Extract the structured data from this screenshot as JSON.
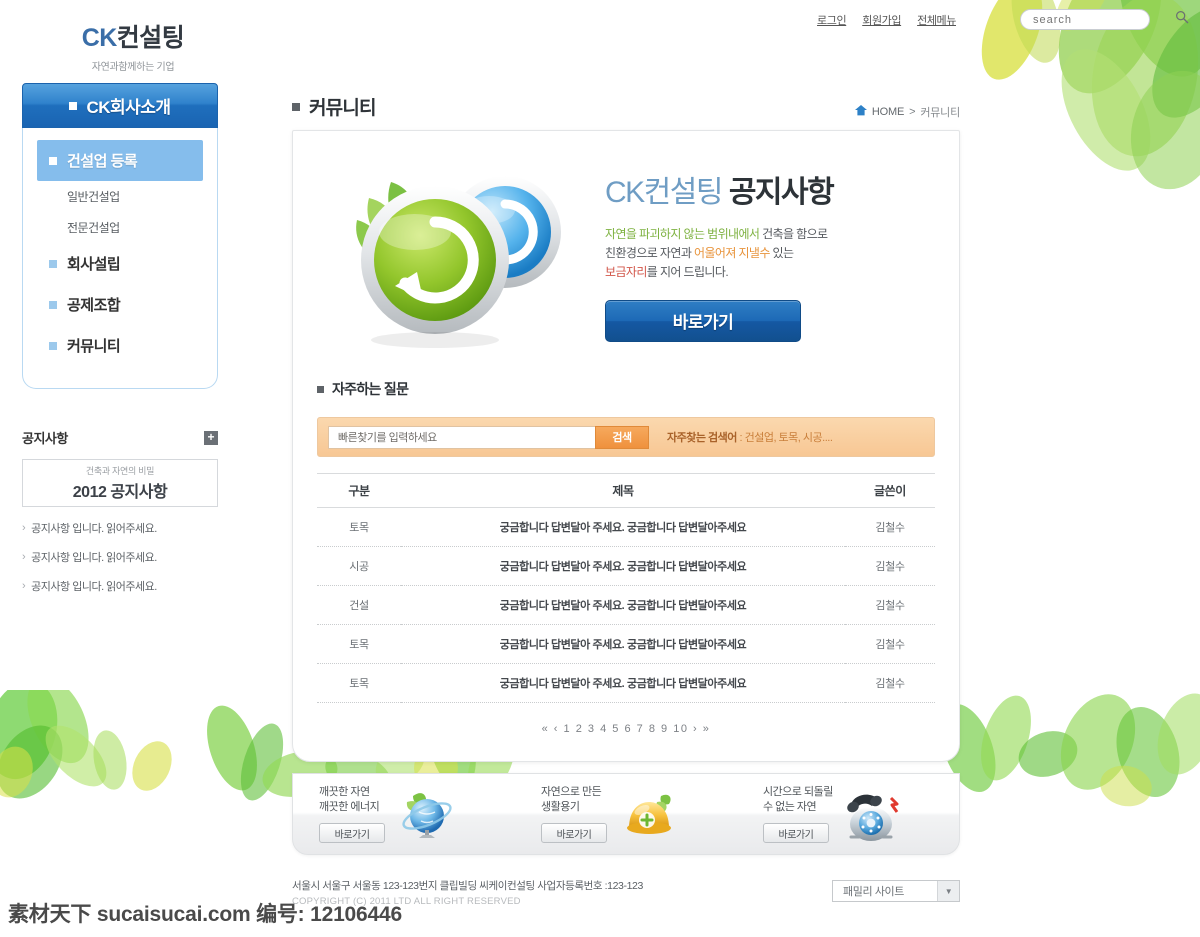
{
  "brand": {
    "logo_ck": "CK",
    "logo_kor": "컨설팅",
    "tagline": "자연과함께하는 기업"
  },
  "utility_nav": {
    "items": [
      {
        "label": "로그인"
      },
      {
        "label": "회원가입"
      },
      {
        "label": "전체메뉴"
      }
    ],
    "search_placeholder": "search",
    "search_value": ""
  },
  "sidebar": {
    "header": "CK회사소개",
    "items": [
      {
        "label": "건설업 등록",
        "active": true
      },
      {
        "label": "회사설립",
        "active": false
      },
      {
        "label": "공제조합",
        "active": false
      },
      {
        "label": "커뮤니티",
        "active": false
      }
    ],
    "sub_items": [
      {
        "label": "일반건설업"
      },
      {
        "label": "전문건설업"
      }
    ]
  },
  "notice": {
    "title": "공지사항",
    "plus": "+",
    "banner_small": "건축과 자연의 비밀",
    "banner_big": "2012 공지사항",
    "links": [
      {
        "label": "공지사항 입니다. 읽어주세요."
      },
      {
        "label": "공지사항 입니다. 읽어주세요."
      },
      {
        "label": "공지사항 입니다. 읽어주세요."
      }
    ]
  },
  "page": {
    "title": "커뮤니티",
    "breadcrumb_home": "HOME",
    "breadcrumb_sep": ">",
    "breadcrumb_current": "커뮤니티"
  },
  "hero": {
    "title_light": "CK컨설팅",
    "title_bold": "공지사항",
    "line1_a": "자연을 파괴하지 않는 범위내에서",
    "line1_b": " 건축을 함으로",
    "line2_a": "친환경으로 자연과 ",
    "line2_b": "어울어져 지낼수",
    "line2_c": " 있는",
    "line3_a": "보금자리",
    "line3_b": "를 지어 드립니다.",
    "button": "바로가기"
  },
  "faq": {
    "section_title": "자주하는 질문",
    "input_value": "빠른찾기를 입력하세요",
    "input_placeholder": "빠른찾기를 입력하세요",
    "search_button": "검색",
    "hint_label": "자주찾는 검색어",
    "hint_value": ": 건설업, 토목, 시공....",
    "columns": [
      "구분",
      "제목",
      "글쓴이"
    ],
    "rows": [
      {
        "category": "토목",
        "title": "궁금합니다 답변달아 주세요. 궁금합니다 답변달아주세요",
        "author": "김철수"
      },
      {
        "category": "시공",
        "title": "궁금합니다 답변달아 주세요. 궁금합니다 답변달아주세요",
        "author": "김철수"
      },
      {
        "category": "건설",
        "title": "궁금합니다 답변달아 주세요. 궁금합니다 답변달아주세요",
        "author": "김철수"
      },
      {
        "category": "토목",
        "title": "궁금합니다 답변달아 주세요. 궁금합니다 답변달아주세요",
        "author": "김철수"
      },
      {
        "category": "토목",
        "title": "궁금합니다 답변달아 주세요. 궁금합니다 답변달아주세요",
        "author": "김철수"
      }
    ],
    "pagination": {
      "first": "«",
      "prev": "‹",
      "pages": [
        "1",
        "2",
        "3",
        "4",
        "5",
        "6",
        "7",
        "8",
        "9",
        "10"
      ],
      "next": "›",
      "last": "»"
    }
  },
  "footer_banner": {
    "cells": [
      {
        "line1": "깨끗한 자연",
        "line2": "깨끗한 에너지",
        "button": "바로가기",
        "icon": "globe-icon"
      },
      {
        "line1": "자연으로 만든",
        "line2": "생활용기",
        "button": "바로가기",
        "icon": "helmet-icon"
      },
      {
        "line1": "시간으로 되돌릴",
        "line2": "수 없는 자연",
        "button": "바로가기",
        "icon": "telephone-icon"
      }
    ]
  },
  "footer": {
    "address": "서울시 서울구 서울동 123-123번지 클립빌딩 씨케이컨설팅 사업자등록번호 :123-123",
    "copyright": "COPYRIGHT (C) 2011 LTD ALL RIGHT RESERVED",
    "family_site": "패밀리 사이트",
    "family_arrow": "▼"
  },
  "watermark": {
    "text": "素材天下 sucaisucai.com 编号: 12106446"
  },
  "colors": {
    "brand_blue": "#1f6fbd",
    "accent_sky": "#85bdec",
    "orange": "#ef913d",
    "leaf_green": "#7eb241"
  }
}
